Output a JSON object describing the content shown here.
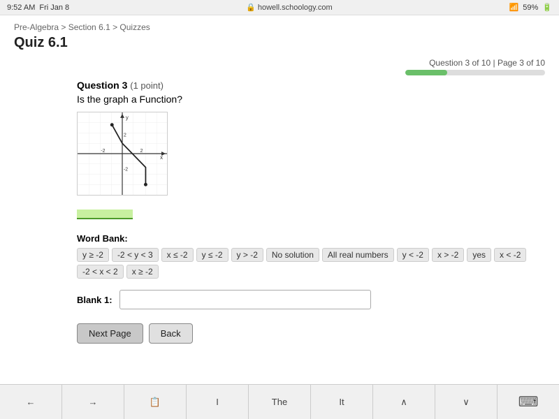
{
  "status_bar": {
    "time": "9:52 AM",
    "day": "Fri Jan 8",
    "url": "howell.schoology.com",
    "wifi": "59%",
    "lock": "🔒"
  },
  "breadcrumb": "Pre-Algebra > Section 6.1 > Quizzes",
  "quiz": {
    "title": "Quiz 6.1",
    "progress_label": "Question 3 of 10 | Page 3 of 10",
    "progress_percent": 30,
    "question_number": "3",
    "question_points": "(1 point)",
    "question_text": "Is the graph a Function?",
    "word_bank_label": "Word Bank:",
    "word_bank_items": [
      "y ≥ -2",
      "-2 < y < 3",
      "x ≤ -2",
      "y ≤ -2",
      "y > -2",
      "No solution",
      "All real numbers",
      "y < -2",
      "x > -2",
      "yes",
      "x < -2",
      "-2 < x < 2",
      "x ≥ -2"
    ],
    "blank_label": "Blank 1:",
    "blank_value": "",
    "next_page_label": "Next Page",
    "back_label": "Back"
  },
  "bottom_nav": {
    "items": [
      "←",
      "→",
      "📋",
      "I",
      "The",
      "It",
      "∧",
      "∨",
      "⌨"
    ]
  }
}
